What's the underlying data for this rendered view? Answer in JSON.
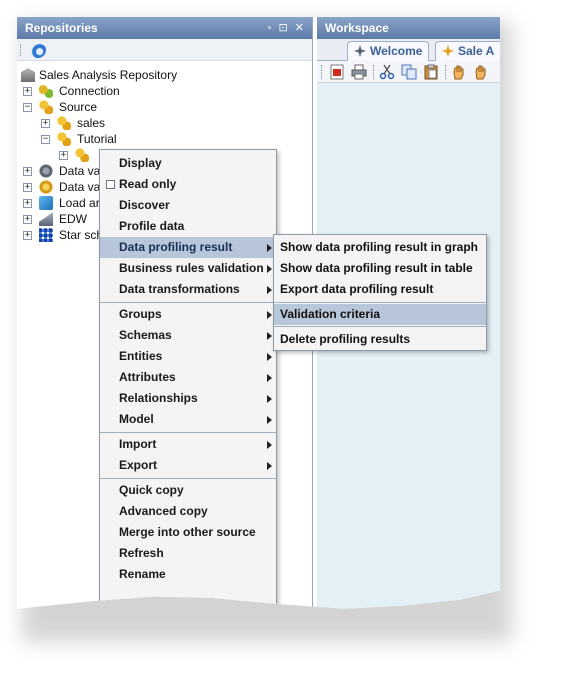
{
  "repositories": {
    "title": "Repositories",
    "header_controls": "▫ ⊡ ✕"
  },
  "tree": {
    "root": "Sales Analysis Repository",
    "connection": "Connection",
    "source": "Source",
    "sales": "sales",
    "tutorial": "Tutorial",
    "selected_node": "",
    "data_va_1": "Data va",
    "data_va_2": "Data va",
    "load_ar": "Load ar",
    "edw": "EDW",
    "star_sch": "Star sch"
  },
  "workspace": {
    "title": "Workspace",
    "tabs": [
      {
        "label": "Welcome"
      },
      {
        "label": "Sale A"
      }
    ]
  },
  "context_menu": {
    "items": [
      {
        "label": "Display",
        "submenu": false
      },
      {
        "label": "Read only",
        "submenu": false,
        "checkbox": true
      },
      {
        "label": "Discover",
        "submenu": false
      },
      {
        "label": "Profile data",
        "submenu": false
      },
      {
        "label": "Data profiling result",
        "submenu": true,
        "active": true
      },
      {
        "label": "Business rules validation",
        "submenu": true
      },
      {
        "label": "Data transformations",
        "submenu": true
      },
      {
        "label": "Groups",
        "submenu": true
      },
      {
        "label": "Schemas",
        "submenu": true
      },
      {
        "label": "Entities",
        "submenu": true
      },
      {
        "label": "Attributes",
        "submenu": true
      },
      {
        "label": "Relationships",
        "submenu": true
      },
      {
        "label": "Model",
        "submenu": true
      },
      {
        "label": "Import",
        "submenu": true
      },
      {
        "label": "Export",
        "submenu": true
      },
      {
        "label": "Quick copy",
        "submenu": false
      },
      {
        "label": "Advanced copy",
        "submenu": false
      },
      {
        "label": "Merge into other source",
        "submenu": false
      },
      {
        "label": "Refresh",
        "submenu": false
      },
      {
        "label": "Rename",
        "submenu": false
      }
    ]
  },
  "profiling_submenu": {
    "items": [
      {
        "label": "Show data profiling result in graph"
      },
      {
        "label": "Show data profiling result in table"
      },
      {
        "label": "Export data profiling result"
      },
      {
        "label": "Validation criteria",
        "active": true
      },
      {
        "label": "Delete profiling results"
      }
    ]
  },
  "colors": {
    "header": "#5d7aa8",
    "menu_highlight": "#b8c6d9",
    "workspace_bg": "#e3f1f7"
  }
}
